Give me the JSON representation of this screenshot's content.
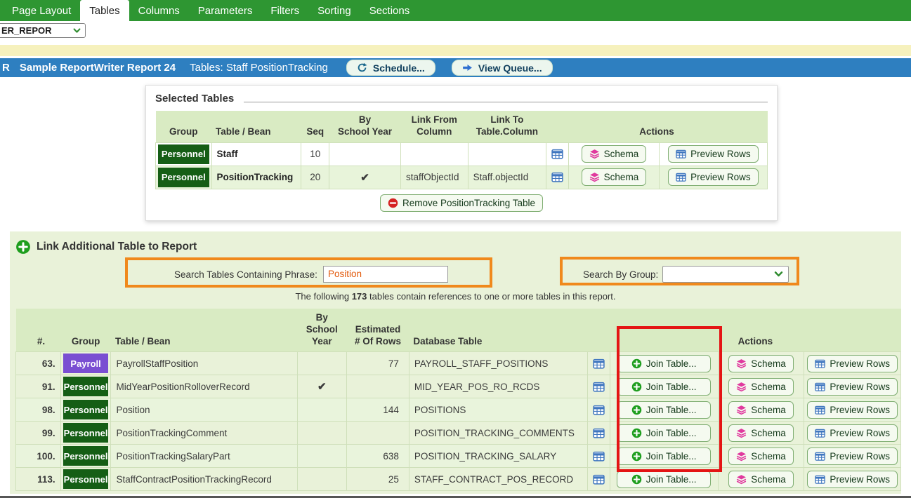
{
  "nav": {
    "tabs": [
      {
        "label": "Page Layout"
      },
      {
        "label": "Tables"
      },
      {
        "label": "Columns"
      },
      {
        "label": "Parameters"
      },
      {
        "label": "Filters"
      },
      {
        "label": "Sorting"
      },
      {
        "label": "Sections"
      }
    ],
    "active_tab": "Tables"
  },
  "report_selector": {
    "value": "ER_REPOR"
  },
  "title_bar": {
    "prefix": "R",
    "report_title": "Sample ReportWriter Report 24",
    "context": "Tables: Staff PositionTracking",
    "schedule_button": "Schedule...",
    "view_queue_button": "View Queue..."
  },
  "selected_tables": {
    "title": "Selected Tables",
    "headers": {
      "group": "Group",
      "table": "Table / Bean",
      "seq": "Seq",
      "by_school_year": "By\nSchool Year",
      "link_from": "Link From\nColumn",
      "link_to": "Link To\nTable.Column",
      "actions": "Actions"
    },
    "rows": [
      {
        "group": "Personnel",
        "table": "Staff",
        "seq": "10",
        "by_school_year": "",
        "link_from": "",
        "link_to": ""
      },
      {
        "group": "Personnel",
        "table": "PositionTracking",
        "seq": "20",
        "by_school_year": "✔",
        "link_from": "staffObjectId",
        "link_to": "Staff.objectId"
      }
    ],
    "schema_button": "Schema",
    "preview_button": "Preview Rows",
    "remove_button": "Remove PositionTracking Table"
  },
  "link_section": {
    "title": "Link Additional Table to Report",
    "search_phrase_label": "Search Tables Containing Phrase:",
    "search_phrase_value": "Position",
    "search_group_label": "Search By Group:",
    "search_group_value": "",
    "note_prefix": "The following ",
    "note_count": "173",
    "note_suffix": " tables contain references to one or more tables in this report.",
    "headers": {
      "num": "#.",
      "group": "Group",
      "table": "Table / Bean",
      "by_school_year": "By\nSchool Year",
      "est_rows": "Estimated\n# Of Rows",
      "db_table": "Database Table",
      "actions": "Actions"
    },
    "join_button": "Join Table...",
    "schema_button": "Schema",
    "preview_button": "Preview Rows",
    "rows": [
      {
        "num": "63.",
        "group": "Payroll",
        "table": "PayrollStaffPosition",
        "by_school_year": "",
        "est_rows": "77",
        "db_table": "PAYROLL_STAFF_POSITIONS"
      },
      {
        "num": "91.",
        "group": "Personnel",
        "table": "MidYearPositionRolloverRecord",
        "by_school_year": "✔",
        "est_rows": "",
        "db_table": "MID_YEAR_POS_RO_RCDS"
      },
      {
        "num": "98.",
        "group": "Personnel",
        "table": "Position",
        "by_school_year": "",
        "est_rows": "144",
        "db_table": "POSITIONS"
      },
      {
        "num": "99.",
        "group": "Personnel",
        "table": "PositionTrackingComment",
        "by_school_year": "",
        "est_rows": "",
        "db_table": "POSITION_TRACKING_COMMENTS"
      },
      {
        "num": "100.",
        "group": "Personnel",
        "table": "PositionTrackingSalaryPart",
        "by_school_year": "",
        "est_rows": "638",
        "db_table": "POSITION_TRACKING_SALARY"
      },
      {
        "num": "113.",
        "group": "Personnel",
        "table": "StaffContractPositionTrackingRecord",
        "by_school_year": "",
        "est_rows": "25",
        "db_table": "STAFF_CONTRACT_POS_RECORD"
      }
    ]
  },
  "icons": {
    "schedule_icon": "circular-arrows",
    "view_queue_icon": "right-arrow",
    "table_icon": "blue-grid",
    "schema_icon": "pink-layers",
    "join_icon": "green-plus-circle",
    "remove_icon": "red-minus-circle",
    "add_icon": "green-plus-circle",
    "select_chevron": "green-chevron-down"
  },
  "colors": {
    "nav_green": "#2e9632",
    "title_bar_blue": "#2e7fc0",
    "yellow_bar": "#f6f1bd",
    "personnel_badge": "#155e15",
    "payroll_badge": "#7a4ed2",
    "schema_icon_pink": "#e0399e",
    "annotation_orange": "#f0891c",
    "annotation_red": "#e41414",
    "search_value_orange": "#e2590b"
  }
}
